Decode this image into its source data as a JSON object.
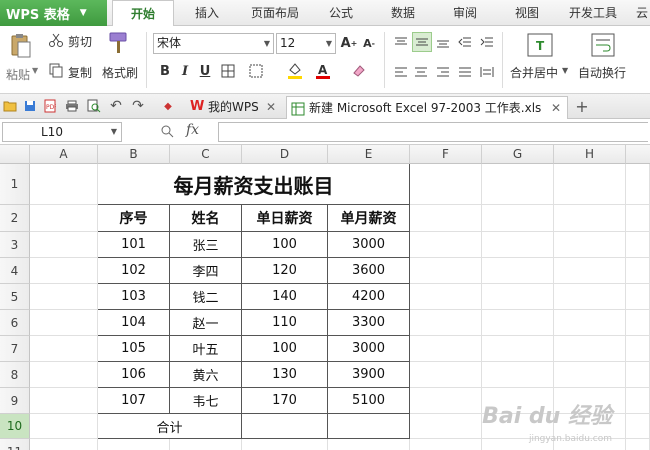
{
  "app": {
    "name": "WPS 表格"
  },
  "menu_tabs": [
    "开始",
    "插入",
    "页面布局",
    "公式",
    "数据",
    "审阅",
    "视图",
    "开发工具",
    "云"
  ],
  "ribbon": {
    "paste_label": "粘贴",
    "cut_label": "剪切",
    "copy_label": "复制",
    "format_painter_label": "格式刷",
    "font_name": "宋体",
    "font_size": "12",
    "bold": "B",
    "italic": "I",
    "underline": "U",
    "merge_center_label": "合并居中",
    "wrap_text_label": "自动换行"
  },
  "doc_tabs": [
    {
      "label": "我的WPS",
      "active": false
    },
    {
      "label": "新建 Microsoft Excel 97-2003 工作表.xls",
      "active": true
    }
  ],
  "formula_bar": {
    "name_box": "L10",
    "fx": "fx",
    "formula": ""
  },
  "columns": [
    "A",
    "B",
    "C",
    "D",
    "E",
    "F",
    "G",
    "H"
  ],
  "rows": [
    "1",
    "2",
    "3",
    "4",
    "5",
    "6",
    "7",
    "8",
    "9",
    "10",
    "11"
  ],
  "selected_row": "10",
  "sheet": {
    "title": "每月薪资支出账目",
    "headers": [
      "序号",
      "姓名",
      "单日薪资",
      "单月薪资"
    ],
    "records": [
      [
        "101",
        "张三",
        "100",
        "3000"
      ],
      [
        "102",
        "李四",
        "120",
        "3600"
      ],
      [
        "103",
        "钱二",
        "140",
        "4200"
      ],
      [
        "104",
        "赵一",
        "110",
        "3300"
      ],
      [
        "105",
        "叶五",
        "100",
        "3000"
      ],
      [
        "106",
        "黄六",
        "130",
        "3900"
      ],
      [
        "107",
        "韦七",
        "170",
        "5100"
      ]
    ],
    "total_label": "合计"
  },
  "watermark": {
    "text": "Bai du 经验",
    "sub": "jingyan.baidu.com"
  },
  "colors": {
    "accent": "#3f9a3f",
    "selection": "#2d8a2d"
  }
}
